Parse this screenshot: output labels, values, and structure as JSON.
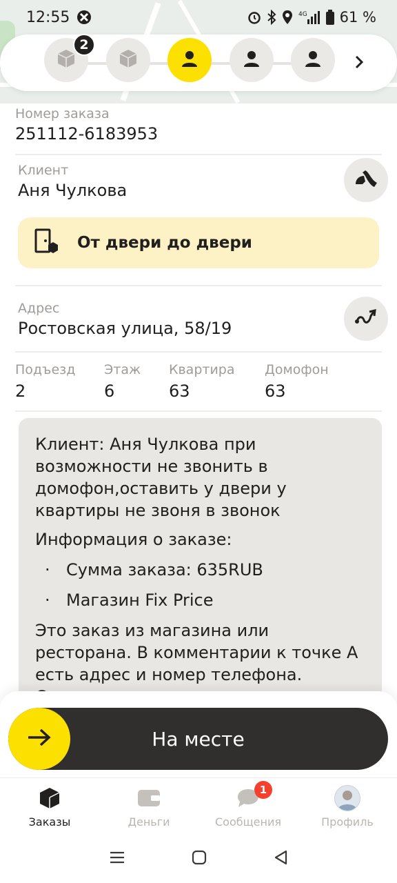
{
  "status_bar": {
    "time": "12:55",
    "battery": "61 %",
    "network": "4G"
  },
  "stepper": {
    "steps": [
      {
        "icon": "package-icon",
        "badge": "2",
        "active": false
      },
      {
        "icon": "package-icon",
        "badge": "",
        "active": false
      },
      {
        "icon": "person-icon",
        "badge": "",
        "active": true
      },
      {
        "icon": "person-icon",
        "badge": "",
        "active": false
      },
      {
        "icon": "person-icon",
        "badge": "",
        "active": false
      }
    ],
    "next_icon": "chevron-right-icon",
    "active_color": "#fce000"
  },
  "order": {
    "label": "Номер заказа",
    "value": "251112-6183953"
  },
  "client": {
    "label": "Клиент",
    "value": "Аня Чулкова",
    "call_icon": "phone-icon"
  },
  "delivery": {
    "label": "От двери до двери",
    "icon": "door-package-icon"
  },
  "address": {
    "label": "Адрес",
    "value": "Ростовская улица, 58/19",
    "route_icon": "route-icon"
  },
  "details": [
    {
      "label": "Подъезд",
      "value": "2"
    },
    {
      "label": "Этаж",
      "value": "6"
    },
    {
      "label": "Квартира",
      "value": "63"
    },
    {
      "label": "Домофон",
      "value": "63"
    }
  ],
  "comment": {
    "text": "Клиент: Аня Чулкова при возможности не звонить в домофон,оставить у двери у квартиры не звоня в звонок",
    "info_title": "Информация о заказе:",
    "items": [
      "Сумма заказа: 635RUB",
      "Магазин Fix Price"
    ],
    "footer": "Это заказ из магазина или ресторана. В комментарии к точке А есть адрес и номер телефона. Скажите"
  },
  "slider": {
    "label": "На месте",
    "icon": "arrow-right-icon"
  },
  "tabs": [
    {
      "label": "Заказы",
      "icon": "orders-icon",
      "active": true,
      "badge": ""
    },
    {
      "label": "Деньги",
      "icon": "wallet-icon",
      "active": false,
      "badge": ""
    },
    {
      "label": "Сообщения",
      "icon": "chat-icon",
      "active": false,
      "badge": "1"
    },
    {
      "label": "Профиль",
      "icon": "avatar",
      "active": false,
      "badge": ""
    }
  ],
  "android_nav": [
    "menu-icon",
    "home-icon",
    "back-icon"
  ]
}
